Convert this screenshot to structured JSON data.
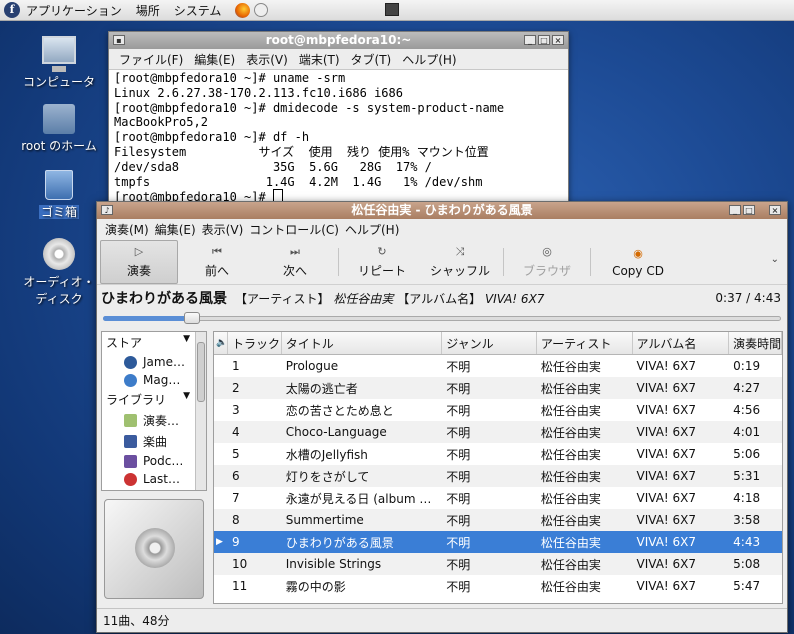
{
  "top_panel": {
    "menus": [
      "アプリケーション",
      "場所",
      "システム"
    ]
  },
  "desktop": {
    "icons": [
      {
        "label": "コンピュータ",
        "icon": "computer-icon"
      },
      {
        "label": "root のホーム",
        "icon": "home-folder-icon"
      },
      {
        "label": "ゴミ箱",
        "icon": "trash-icon"
      },
      {
        "label": "オーディオ・ディスク",
        "icon": "audio-disc-icon"
      }
    ]
  },
  "terminal": {
    "title": "root@mbpfedora10:~",
    "menus": [
      "ファイル(F)",
      "編集(E)",
      "表示(V)",
      "端末(T)",
      "タブ(T)",
      "ヘルプ(H)"
    ],
    "lines": [
      "[root@mbpfedora10 ~]# uname -srm",
      "Linux 2.6.27.38-170.2.113.fc10.i686 i686",
      "[root@mbpfedora10 ~]# dmidecode -s system-product-name",
      "MacBookPro5,2",
      "[root@mbpfedora10 ~]# df -h",
      "Filesystem          サイズ  使用  残り 使用% マウント位置",
      "/dev/sda8             35G  5.6G   28G  17% /",
      "tmpfs                1.4G  4.2M  1.4G   1% /dev/shm",
      "[root@mbpfedora10 ~]# "
    ]
  },
  "player": {
    "title": "松任谷由実 - ひまわりがある風景",
    "menus": [
      "演奏(M)",
      "編集(E)",
      "表示(V)",
      "コントロール(C)",
      "ヘルプ(H)"
    ],
    "toolbar": {
      "play": "演奏",
      "prev": "前へ",
      "next": "次へ",
      "repeat": "リピート",
      "shuffle": "シャッフル",
      "browser": "ブラウザ",
      "copy_cd": "Copy CD"
    },
    "now_playing": {
      "song": "ひまわりがある風景",
      "artist_label": "【アーティスト】",
      "artist": "松任谷由実",
      "album_label": "【アルバム名】",
      "album": "VIVA! 6X7",
      "time": "0:37 / 4:43",
      "progress": 0.131
    },
    "sidebar": {
      "store_header": "ストア",
      "store_items": [
        "Jame…",
        "Mag…"
      ],
      "library_header": "ライブラリ",
      "library_items": [
        "演奏…",
        "楽曲",
        "Podc…",
        "Last…"
      ]
    },
    "columns": [
      "トラック",
      "タイトル",
      "ジャンル",
      "アーティスト",
      "アルバム名",
      "演奏時間"
    ],
    "tracks": [
      {
        "track": "1",
        "title": "Prologue",
        "genre": "不明",
        "artist": "松任谷由実",
        "album": "VIVA! 6X7",
        "time": "0:19"
      },
      {
        "track": "2",
        "title": "太陽の逃亡者",
        "genre": "不明",
        "artist": "松任谷由実",
        "album": "VIVA! 6X7",
        "time": "4:27"
      },
      {
        "track": "3",
        "title": "恋の苦さとため息と",
        "genre": "不明",
        "artist": "松任谷由実",
        "album": "VIVA! 6X7",
        "time": "4:56"
      },
      {
        "track": "4",
        "title": "Choco-Language",
        "genre": "不明",
        "artist": "松任谷由実",
        "album": "VIVA! 6X7",
        "time": "4:01"
      },
      {
        "track": "5",
        "title": "水槽のJellyfish",
        "genre": "不明",
        "artist": "松任谷由実",
        "album": "VIVA! 6X7",
        "time": "5:06"
      },
      {
        "track": "6",
        "title": "灯りをさがして",
        "genre": "不明",
        "artist": "松任谷由実",
        "album": "VIVA! 6X7",
        "time": "5:31"
      },
      {
        "track": "7",
        "title": "永遠が見える日 (album …",
        "genre": "不明",
        "artist": "松任谷由実",
        "album": "VIVA! 6X7",
        "time": "4:18"
      },
      {
        "track": "8",
        "title": "Summertime",
        "genre": "不明",
        "artist": "松任谷由実",
        "album": "VIVA! 6X7",
        "time": "3:58"
      },
      {
        "track": "9",
        "title": "ひまわりがある風景",
        "genre": "不明",
        "artist": "松任谷由実",
        "album": "VIVA! 6X7",
        "time": "4:43",
        "playing": true
      },
      {
        "track": "10",
        "title": "Invisible Strings",
        "genre": "不明",
        "artist": "松任谷由実",
        "album": "VIVA! 6X7",
        "time": "5:08"
      },
      {
        "track": "11",
        "title": "霧の中の影",
        "genre": "不明",
        "artist": "松任谷由実",
        "album": "VIVA! 6X7",
        "time": "5:47"
      }
    ],
    "status": "11曲、48分"
  }
}
